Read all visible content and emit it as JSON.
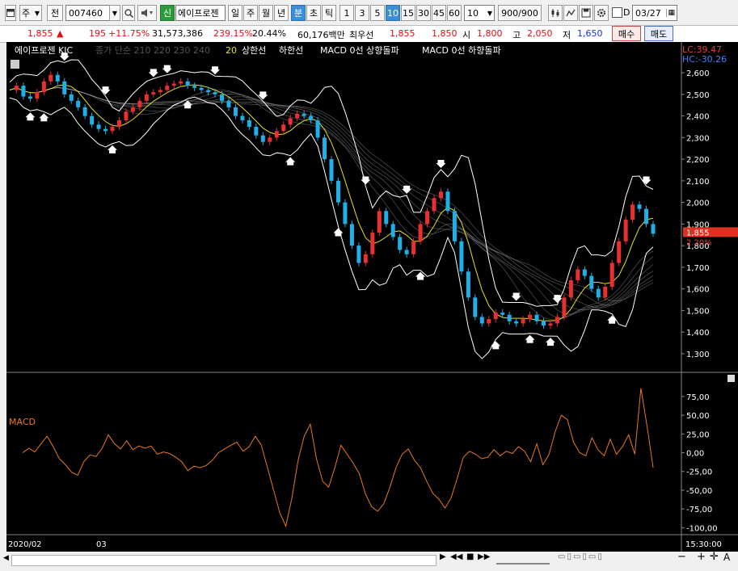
{
  "toolbar": {
    "market": "주",
    "type_btn": "전",
    "code": "007460",
    "badge": "신",
    "name": "에이프로젠",
    "periods": [
      "일",
      "주",
      "월",
      "년",
      "분",
      "초",
      "틱"
    ],
    "active_period": "분",
    "intervals": [
      "1",
      "3",
      "5",
      "10",
      "15",
      "30",
      "45",
      "60"
    ],
    "active_interval": "10",
    "interval_select": "10",
    "count": "900/900",
    "checkbox_label": "D",
    "date": "03/27"
  },
  "info": {
    "price": "1,855",
    "arrow": "▲",
    "change": "195",
    "change_pct": "+11.75%",
    "volume": "31,573,386",
    "vol_ratio": "239.15%",
    "turnover": "20.44%",
    "amount": "60,176백만",
    "best_label": "최우선",
    "best_ask": "1,855",
    "best_bid": "1,850",
    "open_label": "시",
    "open": "1,800",
    "high_label": "고",
    "high": "2,050",
    "low_label": "저",
    "low": "1,650",
    "buy": "매수",
    "sell": "매도"
  },
  "legend": {
    "title": "에이프로젠 KIC",
    "ma": "종가 단순 210 220 230 240",
    "ma20": "20",
    "upper": "상한선",
    "lower": "하한선",
    "macd_up": "MACD 0선 상향돌파",
    "macd_down": "MACD 0선 하향돌파",
    "lc": "LC:39.47",
    "hc": "HC:-30.26",
    "price_tag": "1,855",
    "pct_tag": "2.20%"
  },
  "macd_title": "MACD",
  "date_labels": [
    "2020/02",
    "03"
  ],
  "time_label": "15:30:00",
  "colors": {
    "up": "#e83030",
    "down": "#20b0e8",
    "macd": "#e87820",
    "ma20": "#e8e020",
    "band": "#ffffff",
    "tag": "#e03020"
  },
  "chart_data": [
    {
      "type": "candlestick",
      "title": "에이프로젠 KIC",
      "ylim": [
        1240,
        2660
      ],
      "y_ticks": [
        1300,
        1400,
        1500,
        1600,
        1700,
        1800,
        1900,
        2000,
        2100,
        2200,
        2300,
        2400,
        2500,
        2600
      ],
      "y_tick_labels": [
        "1,300",
        "1,400",
        "1,500",
        "1,600",
        "1,700",
        "1,800",
        "1,900",
        "2,000",
        "2,100",
        "2,200",
        "2,300",
        "2,400",
        "2,500",
        "2,600"
      ],
      "close_approx": [
        2520,
        2540,
        2490,
        2480,
        2510,
        2560,
        2590,
        2560,
        2500,
        2470,
        2440,
        2400,
        2360,
        2340,
        2330,
        2350,
        2380,
        2420,
        2440,
        2470,
        2500,
        2510,
        2520,
        2540,
        2550,
        2560,
        2540,
        2530,
        2520,
        2510,
        2500,
        2470,
        2440,
        2400,
        2380,
        2350,
        2310,
        2280,
        2300,
        2330,
        2360,
        2390,
        2410,
        2400,
        2380,
        2300,
        2200,
        2100,
        2000,
        1900,
        1800,
        1720,
        1760,
        1860,
        1960,
        1900,
        1840,
        1780,
        1760,
        1820,
        1900,
        1960,
        2020,
        2050,
        1960,
        1820,
        1680,
        1560,
        1470,
        1440,
        1460,
        1490,
        1480,
        1450,
        1440,
        1460,
        1480,
        1450,
        1430,
        1440,
        1470,
        1560,
        1640,
        1690,
        1660,
        1600,
        1560,
        1610,
        1720,
        1820,
        1920,
        1990,
        1970,
        1900,
        1855
      ]
    },
    {
      "type": "line",
      "title": "MACD",
      "ylim": [
        -105,
        90
      ],
      "y_ticks": [
        75,
        50,
        25,
        0,
        -25,
        -50,
        -75,
        -100
      ],
      "y_tick_labels": [
        "75,00",
        "50,00",
        "25,00",
        "0,00",
        "-25,00",
        "-50,00",
        "-75,00",
        "-100,00"
      ],
      "values": [
        0,
        6,
        1,
        12,
        22,
        8,
        -8,
        -16,
        -26,
        -30,
        -12,
        -3,
        -5,
        6,
        24,
        12,
        5,
        16,
        4,
        9,
        6,
        9,
        -2,
        1,
        -1,
        -6,
        -12,
        -24,
        -18,
        -20,
        -17,
        -10,
        0,
        5,
        10,
        14,
        2,
        8,
        22,
        10,
        -20,
        -50,
        -80,
        -98,
        -60,
        -10,
        22,
        38,
        -8,
        -38,
        -46,
        -20,
        10,
        -2,
        -14,
        -28,
        -55,
        -72,
        -78,
        -68,
        -46,
        -20,
        -2,
        5,
        -10,
        -20,
        -38,
        -54,
        -62,
        -74,
        -60,
        -34,
        -6,
        2,
        -2,
        -8,
        -6,
        4,
        -4,
        2,
        -1,
        8,
        2,
        -12,
        12,
        -16,
        -2,
        28,
        50,
        44,
        14,
        0,
        -4,
        20,
        4,
        -4,
        18,
        -2,
        8,
        24,
        -2,
        86,
        36,
        -20
      ]
    }
  ]
}
